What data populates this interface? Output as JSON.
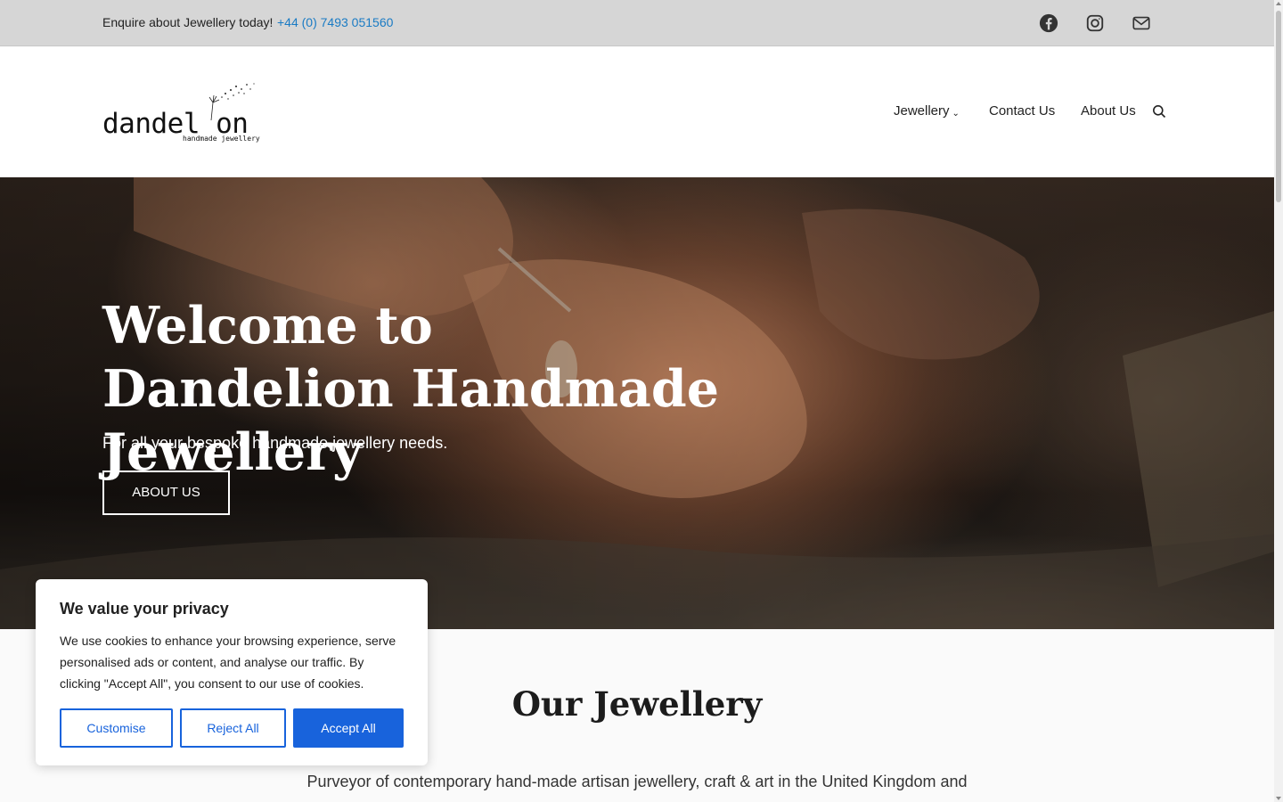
{
  "topbar": {
    "enquire_text": "Enquire about Jewellery today!",
    "phone": "+44 (0) 7493 051560",
    "social_icons": [
      "facebook-icon",
      "instagram-icon",
      "mail-icon"
    ]
  },
  "header": {
    "logo": {
      "word": "dandel on",
      "tagline": "handmade jewellery"
    },
    "nav": [
      {
        "label": "Jewellery",
        "has_dropdown": true
      },
      {
        "label": "Contact Us"
      },
      {
        "label": "About Us"
      }
    ],
    "search_icon": "search-icon"
  },
  "hero": {
    "title": "Welcome to Dandelion Handmade Jewellery",
    "subtitle": "For all your bespoke handmade jewellery needs.",
    "button_label": "ABOUT US"
  },
  "section": {
    "title": "Our Jewellery",
    "text": "Purveyor of contemporary hand-made artisan jewellery, craft & art in the United Kingdom and Europe."
  },
  "cookie": {
    "title": "We value your privacy",
    "body": "We use cookies to enhance your browsing experience, serve personalised ads or content, and analyse our traffic. By clicking \"Accept All\", you consent to our use of cookies.",
    "customise_label": "Customise",
    "reject_label": "Reject All",
    "accept_label": "Accept All"
  },
  "colors": {
    "accent": "#1863dc",
    "phone_link": "#1a7bc4",
    "topbar_bg": "#d6d6d6"
  }
}
